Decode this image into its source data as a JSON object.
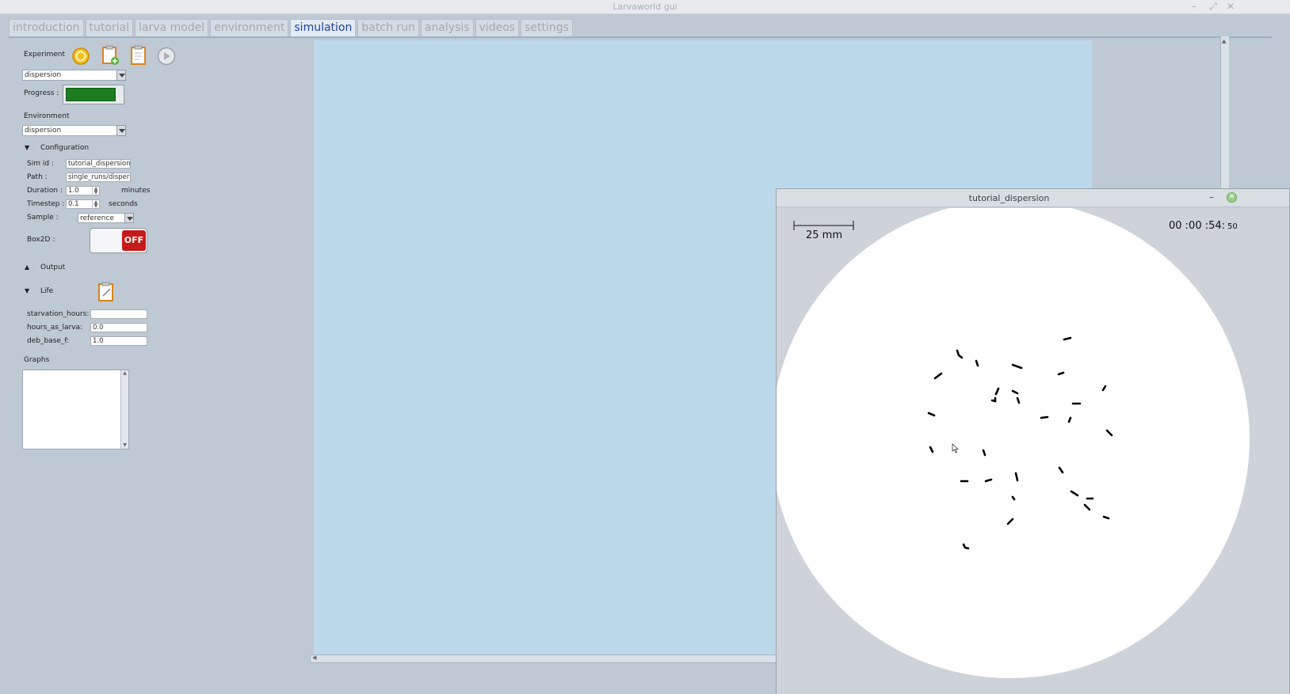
{
  "window": {
    "title": "Larvaworld gui"
  },
  "tabs": [
    {
      "label": "introduction"
    },
    {
      "label": "tutorial"
    },
    {
      "label": "larva model"
    },
    {
      "label": "environment"
    },
    {
      "label": "simulation",
      "active": true
    },
    {
      "label": "batch run"
    },
    {
      "label": "analysis"
    },
    {
      "label": "videos"
    },
    {
      "label": "settings"
    }
  ],
  "panel": {
    "experiment_label": "Experiment",
    "experiment_value": "dispersion",
    "progress_label": "Progress :",
    "progress_fraction": 0.9,
    "environment_label": "Environment",
    "environment_value": "dispersion",
    "configuration": {
      "header": "Configuration",
      "sim_id_label": "Sim id :",
      "sim_id_value": "tutorial_dispersion",
      "path_label": "Path :",
      "path_value": "single_runs/dispersio",
      "duration_label": "Duration :",
      "duration_value": "1.0",
      "duration_unit": "minutes",
      "timestep_label": "Timestep :",
      "timestep_value": "0.1",
      "timestep_unit": "seconds",
      "sample_label": "Sample :",
      "sample_value": "reference",
      "box2d_label": "Box2D :",
      "box2d_state": "OFF"
    },
    "output_header": "Output",
    "life": {
      "header": "Life",
      "starvation_label": "starvation_hours:",
      "starvation_value": "",
      "hours_label": "hours_as_larva:",
      "hours_value": "0.0",
      "deb_label": "deb_base_f:",
      "deb_value": "1.0"
    },
    "graphs_label": "Graphs"
  },
  "simwindow": {
    "title": "tutorial_dispersion",
    "scale_label": "25 mm",
    "clock_main": "00 :00 :54:",
    "clock_frac": "50"
  },
  "colors": {
    "sim_background": "#bcd9ec",
    "progress": "#1b7d1f",
    "off_toggle": "#c51a1a",
    "active_tab_text": "#213f9e"
  }
}
